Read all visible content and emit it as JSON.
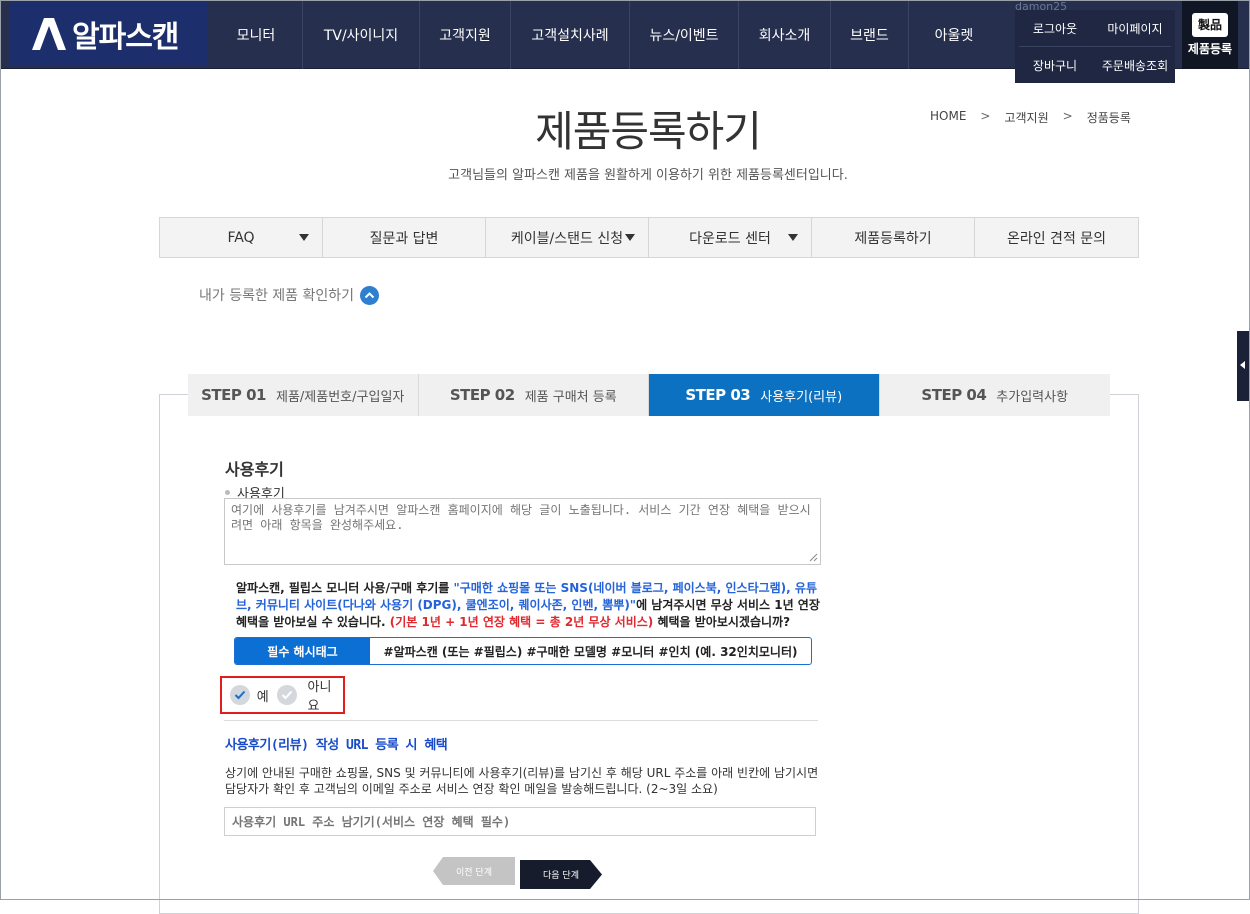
{
  "header": {
    "logo_text": "알파스캔",
    "nav": [
      "모니터",
      "TV/사이니지",
      "고객지원",
      "고객설치사례",
      "뉴스/이벤트",
      "회사소개",
      "브랜드",
      "아울렛"
    ],
    "username": "damon25",
    "user_links": [
      "로그아웃",
      "마이페이지",
      "장바구니",
      "주문배송조회"
    ],
    "register_icon_text": "製品",
    "register_label": "제품등록"
  },
  "page": {
    "title": "제품등록하기",
    "subtitle": "고객님들의 알파스캔 제품을 원활하게 이용하기 위한 제품등록센터입니다.",
    "breadcrumb": [
      "HOME",
      "고객지원",
      "정품등록"
    ]
  },
  "tab_menu": [
    {
      "label": "FAQ"
    },
    {
      "label": "질문과 답변"
    },
    {
      "label": "케이블/스탠드 신청"
    },
    {
      "label": "다운로드 센터"
    },
    {
      "label": "제품등록하기"
    },
    {
      "label": "온라인 견적 문의"
    }
  ],
  "my_products_label": "내가 등록한 제품 확인하기",
  "steps": [
    {
      "num": "STEP 01",
      "label": "제품/제품번호/구입일자"
    },
    {
      "num": "STEP 02",
      "label": "제품 구매처 등록"
    },
    {
      "num": "STEP 03",
      "label": "사용후기(리뷰)"
    },
    {
      "num": "STEP 04",
      "label": "추가입력사항"
    }
  ],
  "review": {
    "section_title": "사용후기",
    "field_label": "사용후기",
    "textarea_placeholder": "여기에 사용후기를 남겨주시면 알파스캔 홈페이지에 해당 글이 노출됩니다. 서비스 기간 연장 혜택을 받으시려면 아래 항목을 완성해주세요.",
    "notice_part1": "알파스캔, 필립스 모니터 사용/구매 후기를 ",
    "notice_blue": "\"구매한 쇼핑몰 또는 SNS(네이버 블로그, 페이스북, 인스타그램), 유튜브, 커뮤니티 사이트(다나와 사용기 (DPG), 쿨엔조이, 퀘이사존, 인벤, 뽐뿌)\"",
    "notice_part2": "에 남겨주시면 무상 서비스 1년 연장 혜택을 받아보실 수 있습니다. ",
    "notice_red": "(기본 1년 + 1년 연장 혜택 = 총 2년 무상 서비스)",
    "notice_part3": " 혜택을 받아보시겠습니까?",
    "hashtag_label": "필수 해시태그",
    "hashtag_text": "#알파스캔 (또는 #필립스) #구매한 모델명 #모니터 #인치 (예. 32인치모니터)",
    "choice_yes": "예",
    "choice_no": "아니요"
  },
  "url_section": {
    "title": "사용후기(리뷰) 작성 URL 등록 시 혜택",
    "desc": "상기에 안내된 구매한 쇼핑몰, SNS 및 커뮤니티에 사용후기(리뷰)를 남기신 후 해당 URL 주소를 아래 빈칸에 남기시면 담당자가 확인 후 고객님의 이메일 주소로 서비스 연장 확인 메일을 발송해드립니다. (2~3일 소요)",
    "input_placeholder": "사용후기 URL 주소 남기기(서비스 연장 혜택 필수)"
  },
  "buttons": {
    "prev": "이전 단계",
    "next": "다음 단계"
  },
  "colors": {
    "header_bg": "#262f4d",
    "logo_bg": "#1c2e6b",
    "active_step": "#0c71c1",
    "accent_blue": "#2563d9",
    "accent_red": "#e0282f",
    "highlight_border": "#e01e1e"
  }
}
